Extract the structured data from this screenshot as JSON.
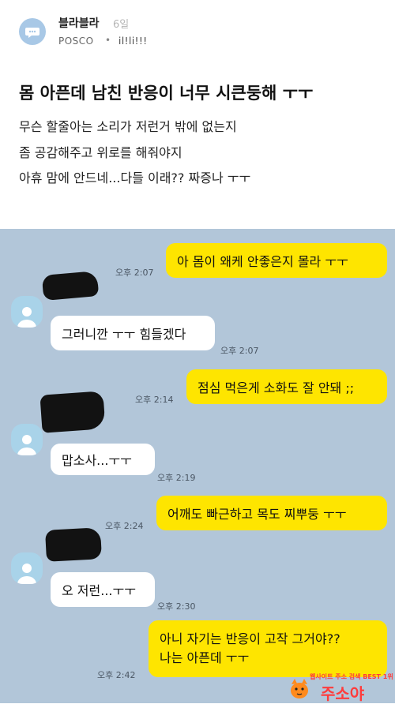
{
  "post": {
    "author": "블라블라",
    "time_ago": "6일",
    "company": "POSCO",
    "separator": "•",
    "nickname": "il!li!!!",
    "title": "몸 아픈데 남친 반응이 너무 시큰둥해 ㅜㅜ",
    "body": [
      "무슨 할줄아는 소리가 저런거 밖에 없는지",
      "좀 공감해주고 위로를 해줘야지",
      "아휴 맘에 안드네...다들 이래?? 짜증나 ㅜㅜ"
    ]
  },
  "chat": {
    "messages": [
      {
        "from": "me",
        "text": "아 몸이 왜케 안좋은지 몰라 ㅜㅜ",
        "time": "오후 2:07"
      },
      {
        "from": "other",
        "text": "그러니깐 ㅜㅜ 힘들겠다",
        "time": "오후 2:07"
      },
      {
        "from": "me",
        "text": "점심 먹은게 소화도 잘 안돼 ;;",
        "time": "오후 2:14"
      },
      {
        "from": "other",
        "text": "맙소사...ㅜㅜ",
        "time": "오후 2:19"
      },
      {
        "from": "me",
        "text": "어깨도 빠근하고 목도 찌뿌둥 ㅜㅜ",
        "time": "오후 2:24"
      },
      {
        "from": "other",
        "text": "오 저런...ㅜㅜ",
        "time": "오후 2:30"
      },
      {
        "from": "me",
        "lines": [
          "아니 자기는 반응이 고작 그거야??",
          "나는 아픈데 ㅜㅜ"
        ],
        "time": "오후 2:42"
      }
    ]
  },
  "watermark": {
    "caption": "웹사이트 주소 검색 BEST 1위",
    "brand": "주소야"
  },
  "colors": {
    "my_bubble": "#fee500",
    "other_bubble": "#ffffff",
    "chat_background": "#b2c6d9",
    "channel_avatar": "#a8c8e6"
  }
}
